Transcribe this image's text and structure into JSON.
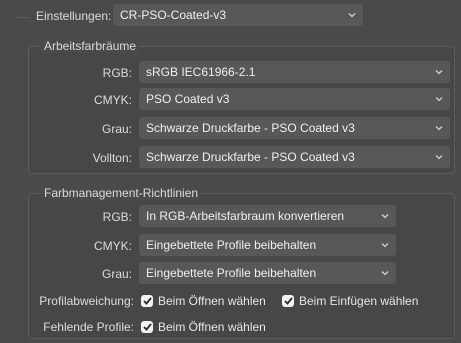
{
  "settings": {
    "label": "Einstellungen:",
    "value": "CR-PSO-Coated-v3"
  },
  "working_spaces": {
    "title": "Arbeitsfarbräume",
    "rows": [
      {
        "label": "RGB:",
        "value": "sRGB IEC61966-2.1"
      },
      {
        "label": "CMYK:",
        "value": "PSO Coated v3"
      },
      {
        "label": "Grau:",
        "value": "Schwarze Druckfarbe - PSO Coated v3"
      },
      {
        "label": "Vollton:",
        "value": "Schwarze Druckfarbe - PSO Coated v3"
      }
    ]
  },
  "policies": {
    "title": "Farbmanagement-Richtlinien",
    "rows": [
      {
        "label": "RGB:",
        "value": "In RGB-Arbeitsfarbraum konvertieren"
      },
      {
        "label": "CMYK:",
        "value": "Eingebettete Profile beibehalten"
      },
      {
        "label": "Grau:",
        "value": "Eingebettete Profile beibehalten"
      }
    ],
    "mismatch": {
      "label": "Profilabweichung:",
      "on_open": {
        "label": "Beim Öffnen wählen",
        "checked": true
      },
      "on_paste": {
        "label": "Beim Einfügen wählen",
        "checked": true
      }
    },
    "missing": {
      "label": "Fehlende Profile:",
      "on_open": {
        "label": "Beim Öffnen wählen",
        "checked": true
      }
    }
  },
  "icons": {
    "dropdown": "chevron-down-icon",
    "checkbox": "checkmark-icon"
  },
  "colors": {
    "background": "#4a4a4a",
    "dropdown": "#585858",
    "checkbox": "#f2f2f2"
  }
}
